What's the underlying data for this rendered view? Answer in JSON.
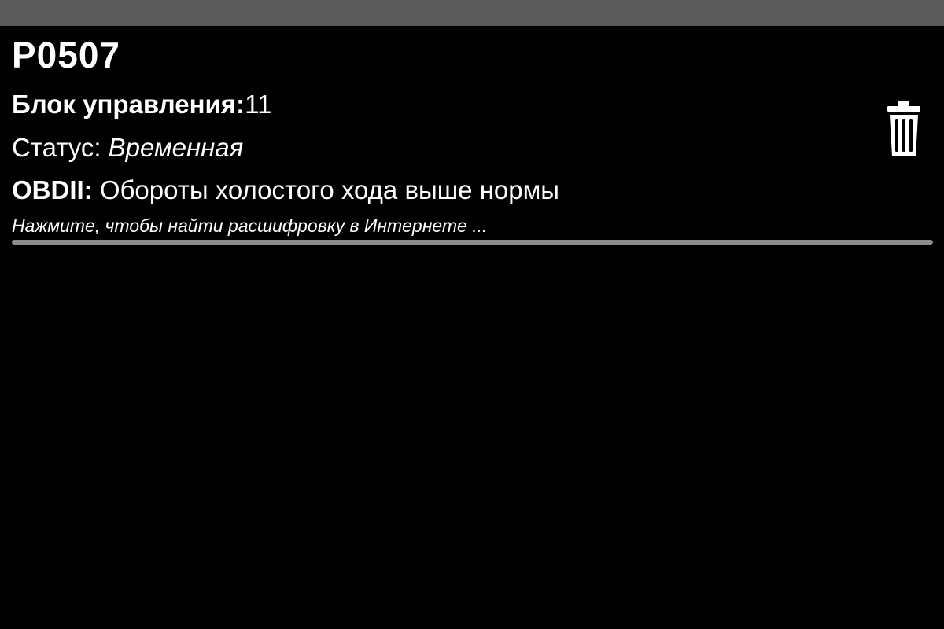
{
  "dtc": {
    "code": "P0507",
    "control_unit_label": "Блок управления:",
    "control_unit_value": "11",
    "status_label": "Статус: ",
    "status_value": "Временная",
    "obd_label": "OBDII:",
    "obd_description": " Обороты холостого хода выше нормы",
    "hint": "Нажмите, чтобы найти расшифровку в Интернете ..."
  },
  "icons": {
    "delete": "trash-icon"
  },
  "colors": {
    "background": "#000000",
    "top_bar": "#5a5a5a",
    "text": "#ffffff",
    "divider": "#8c8c8c"
  }
}
